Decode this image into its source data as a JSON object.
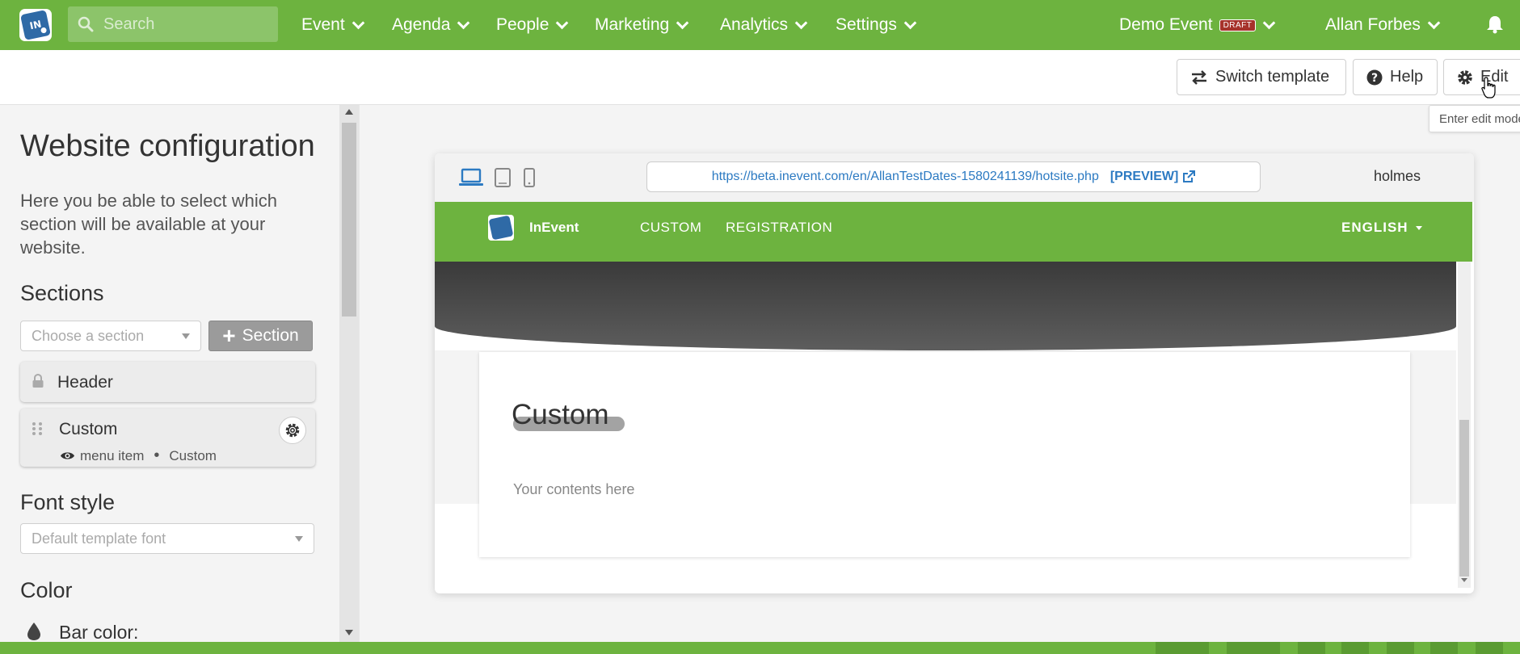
{
  "topbar": {
    "search_placeholder": "Search",
    "nav": [
      {
        "label": "Event"
      },
      {
        "label": "Agenda"
      },
      {
        "label": "People"
      },
      {
        "label": "Marketing"
      },
      {
        "label": "Analytics"
      },
      {
        "label": "Settings"
      }
    ],
    "event_name": "Demo Event",
    "event_status": "DRAFT",
    "user_name": "Allan Forbes",
    "accent_color": "#6db33f"
  },
  "toolbar": {
    "switch_template": "Switch template",
    "help": "Help",
    "edit": "Edit",
    "edit_tooltip": "Enter edit mode"
  },
  "sidebar": {
    "title": "Website configuration",
    "description": "Here you be able to select which section will be available at your website.",
    "sections_heading": "Sections",
    "choose_section_placeholder": "Choose a section",
    "add_section_label": "Section",
    "sections": [
      {
        "title": "Header",
        "icon": "lock-icon"
      },
      {
        "title": "Custom",
        "icon": "drag-handle-icon",
        "visibility": "menu item",
        "type": "Custom"
      }
    ],
    "font_heading": "Font style",
    "font_value": "Default template font",
    "color_heading": "Color",
    "bar_color_label": "Bar color:"
  },
  "preview": {
    "url": "https://beta.inevent.com/en/AllanTestDates-1580241139/hotsite.php",
    "preview_tag": "[PREVIEW]",
    "user": "holmes",
    "site": {
      "brand": "InEvent",
      "links": [
        "CUSTOM",
        "REGISTRATION"
      ],
      "language": "ENGLISH"
    },
    "content_title": "Custom",
    "content_body": "Your contents here"
  }
}
